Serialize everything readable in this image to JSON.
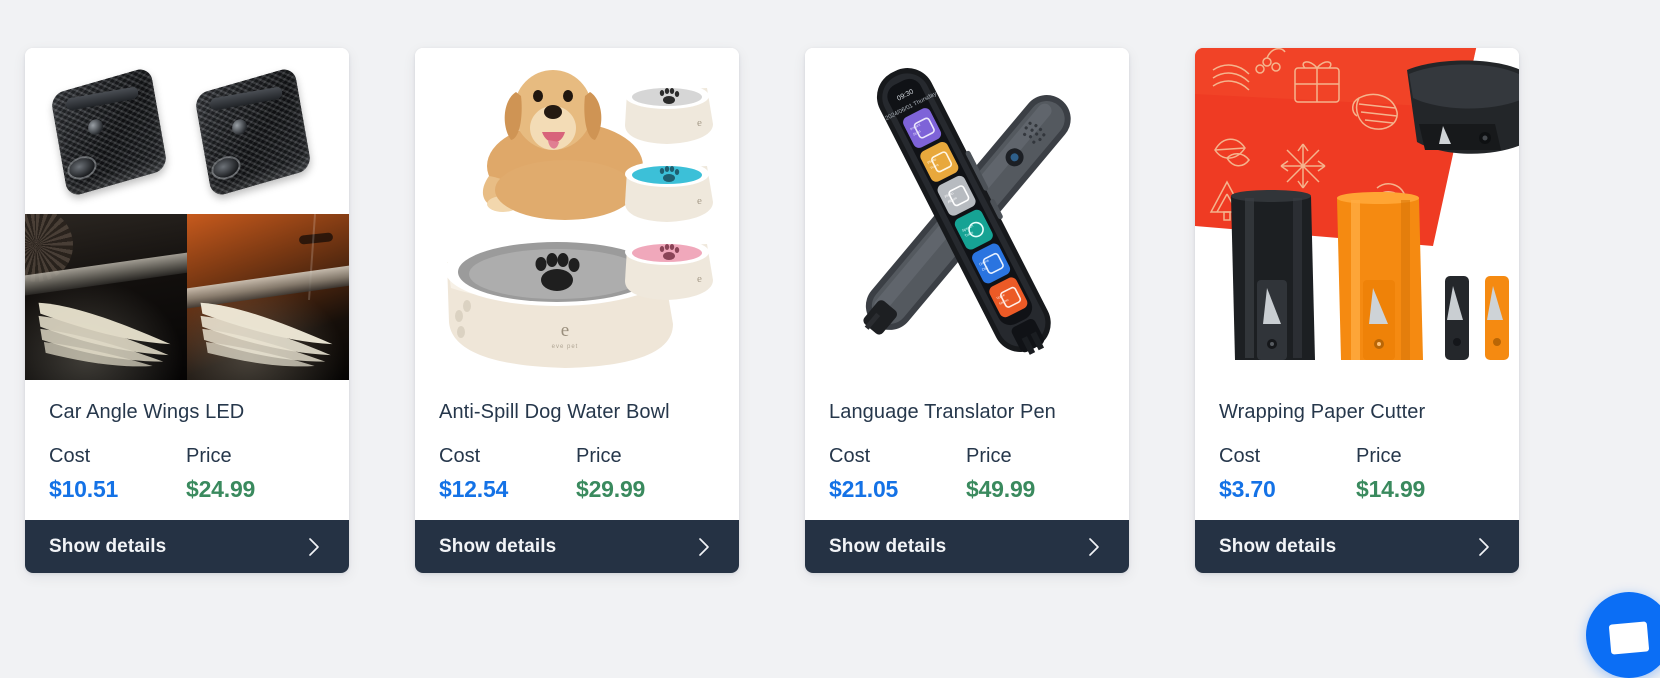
{
  "page": {
    "background_color": "#f1f2f4",
    "layout": "product-card-grid",
    "card_count": 4
  },
  "theme": {
    "card_background": "#ffffff",
    "title_color": "#26374b",
    "cost_color": "#1472e6",
    "price_color": "#3a8a5e",
    "footer_background": "#253244",
    "footer_text_color": "#f2f4f7",
    "chat_button_color": "#0b6ef5"
  },
  "labels": {
    "cost": "Cost",
    "price": "Price",
    "show_details": "Show details"
  },
  "cards": [
    {
      "title": "Car Angle Wings LED",
      "cost_label": "Cost",
      "cost_value": "$10.51",
      "price_label": "Price",
      "price_value": "$24.99",
      "action_label": "Show details",
      "image_alt": "Two black carbon-fiber LED car door projector units above two night photos of car doors projecting white angel wing light logos onto the ground"
    },
    {
      "title": "Anti-Spill Dog Water Bowl",
      "cost_label": "Cost",
      "cost_value": "$12.54",
      "price_label": "Price",
      "price_value": "$29.99",
      "action_label": "Show details",
      "image_alt": "Golden retriever lying behind a large cream anti-spill pet water bowl with a gray floating paw-print disc, with gray, blue and pink color variants stacked at the right"
    },
    {
      "title": "Language Translator Pen",
      "cost_label": "Cost",
      "cost_value": "$21.05",
      "price_label": "Price",
      "price_value": "$49.99",
      "action_label": "Show details",
      "image_alt": "Two black scanning translator pens crossed in an X, the front one showing a color touchscreen with purple, orange, gray, teal, blue and red app tiles"
    },
    {
      "title": "Wrapping Paper Cutter",
      "cost_label": "Cost",
      "cost_value": "$3.70",
      "price_label": "Price",
      "price_value": "$14.99",
      "action_label": "Show details",
      "image_alt": "Red Christmas wrapping paper with gold line-art snowflakes and gifts being cut by a black sliding cutter, with black and orange cylindrical cutter bodies and two spare blade holders below"
    }
  ],
  "chat_widget": {
    "name": "chat-launcher",
    "icon": "chat-bubble-icon",
    "color": "#0b6ef5"
  }
}
